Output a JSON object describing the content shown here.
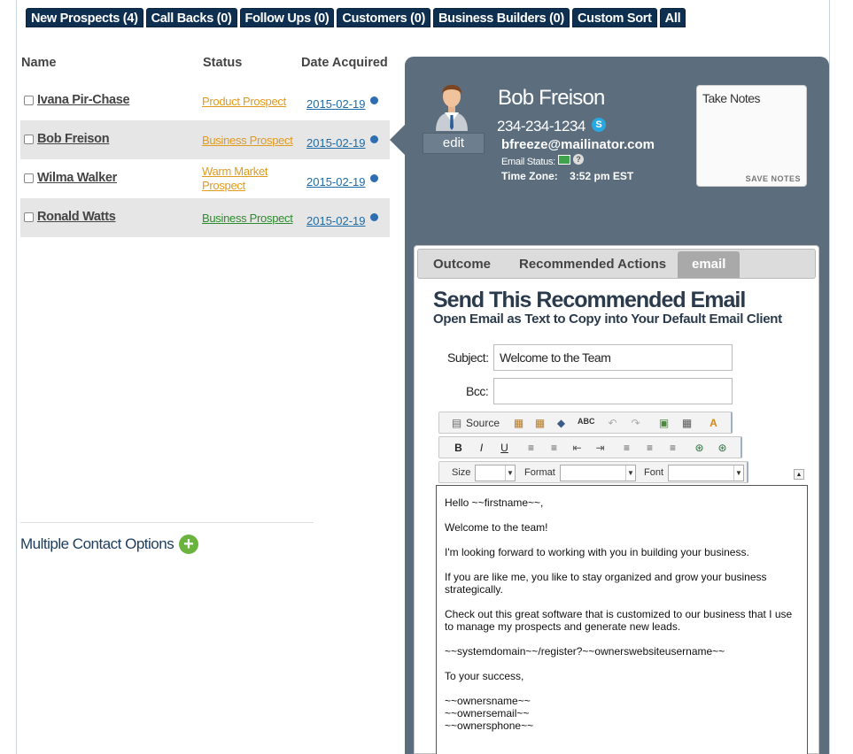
{
  "tabs": [
    "New Prospects (4)",
    "Call Backs (0)",
    "Follow Ups (0)",
    "Customers (0)",
    "Business Builders (0)",
    "Custom Sort",
    "All"
  ],
  "columns": {
    "name": "Name",
    "status": "Status",
    "date": "Date Acquired"
  },
  "prospects": [
    {
      "name": "Ivana Pir-Chase",
      "status": "Product Prospect",
      "status_color": "#e09a1f",
      "date": "2015-02-19"
    },
    {
      "name": "Bob Freison",
      "status": "Business Prospect",
      "status_color": "#e09a1f",
      "date": "2015-02-19"
    },
    {
      "name": "Wilma Walker",
      "status": "Warm Market Prospect",
      "status_color": "#e09a1f",
      "date": "2015-02-19"
    },
    {
      "name": "Ronald Watts",
      "status": "Business Prospect",
      "status_color": "#2e8b2e",
      "date": "2015-02-19"
    }
  ],
  "multi_contact_label": "Multiple Contact Options",
  "contact": {
    "edit_label": "edit",
    "name": "Bob Freison",
    "phone": "234-234-1234",
    "email": "bfreeze@mailinator.com",
    "email_status_label": "Email Status:",
    "timezone_label": "Time Zone:",
    "timezone_value": "3:52 pm EST"
  },
  "notes": {
    "placeholder": "Take Notes",
    "save_label": "SAVE NOTES"
  },
  "subtabs": [
    "Outcome",
    "Recommended Actions",
    "email"
  ],
  "email": {
    "title": "Send This Recommended Email",
    "subtitle": "Open Email as Text to Copy into Your Default Email Client",
    "subject_label": "Subject:",
    "subject_value": "Welcome to the Team",
    "bcc_label": "Bcc:",
    "bcc_value": "",
    "toolbar": {
      "source": "Source",
      "size": "Size",
      "format": "Format",
      "font": "Font"
    },
    "body": [
      "Hello ~~firstname~~,",
      "Welcome to the team!",
      "I'm looking forward to working with you in building your business.",
      "If you are like me, you like to stay organized and grow your business strategically.",
      "Check out this great software that is customized to our business that I use to manage my prospects and generate new leads.",
      "~~systemdomain~~/register?~~ownerswebsiteusername~~",
      "To your success,",
      "~~ownersname~~\n~~ownersemail~~\n~~ownersphone~~"
    ]
  },
  "colors": {
    "navy_tab": "#0e2f4f",
    "panel": "#5c6e7d",
    "link_blue": "#1f6ca7",
    "dot_blue": "#2f6db3"
  }
}
